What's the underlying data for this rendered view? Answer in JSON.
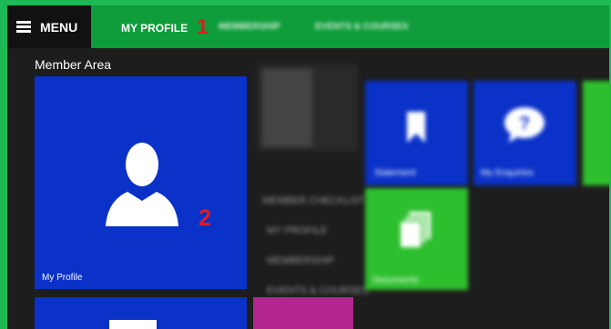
{
  "header": {
    "menu_label": "MENU",
    "nav_items": [
      "MY PROFILE",
      "MEMBERSHIP",
      "EVENTS & COURSES"
    ],
    "step_marker_1": "1"
  },
  "main": {
    "section_title": "Member Area",
    "profile_tile": {
      "label": "My Profile",
      "step_marker_2": "2"
    },
    "right_tiles": [
      "Statement",
      "My Enquiries",
      "Documents"
    ],
    "checklist_title": "MEMBER CHECKLIST",
    "checklist_items": [
      "MY PROFILE",
      "MEMBERSHIP",
      "EVENTS & COURSES"
    ]
  },
  "colors": {
    "header_green": "#0e9d3a",
    "tile_blue": "#0a32c8",
    "tile_green": "#2ebf2e",
    "tile_magenta": "#b3268f",
    "marker_red": "#e31b1b"
  }
}
